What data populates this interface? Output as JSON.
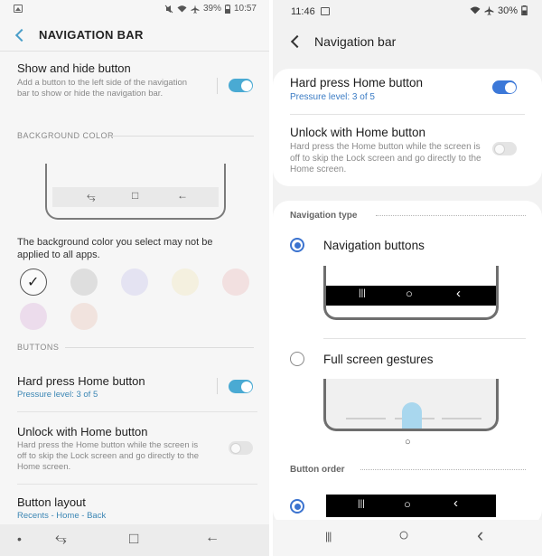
{
  "left": {
    "status": {
      "battery": "39%",
      "time": "10:57"
    },
    "header_title": "NAVIGATION BAR",
    "show_hide": {
      "title": "Show and hide button",
      "subtitle": "Add a button to the left side of the navigation bar to show or hide the navigation bar.",
      "toggle": "on"
    },
    "bg_color_head": "BACKGROUND COLOR",
    "bg_note": "The background color you select may not be applied to all apps.",
    "swatches": [
      "#fafafa",
      "#dedede",
      "#dddcf0",
      "#f3efdc",
      "#f2dede",
      "#ecdcec",
      "#f1e2dd"
    ],
    "buttons_head": "BUTTONS",
    "hard_press": {
      "title": "Hard press Home button",
      "subtitle": "Pressure level: 3 of 5",
      "toggle": "on"
    },
    "unlock": {
      "title": "Unlock with Home button",
      "subtitle": "Hard press the Home button while the screen is off to skip the Lock screen and go directly to the Home screen.",
      "toggle": "off"
    },
    "layout": {
      "title": "Button layout",
      "subtitle": "Recents - Home - Back"
    },
    "icons": {
      "back": "chevron-left-icon",
      "recents": "recents-icon",
      "home": "home-square-icon",
      "nav_back": "back-arrow-icon",
      "check": "checkmark-icon",
      "dot": "dot-icon",
      "status_left": "image-icon",
      "status_right": [
        "mute-icon",
        "wifi-icon",
        "airplane-icon"
      ]
    },
    "glyphs": {
      "recents": "⥃",
      "home": "□",
      "back": "←",
      "dot": "•",
      "check": "✓"
    }
  },
  "right": {
    "status": {
      "time": "11:46",
      "battery": "30%"
    },
    "header_title": "Navigation bar",
    "hard_press": {
      "title": "Hard press Home button",
      "subtitle": "Pressure level: 3 of 5",
      "toggle": "on"
    },
    "unlock": {
      "title": "Unlock with Home button",
      "subtitle": "Hard press the Home button while the screen is off to skip the Lock screen and go directly to the Home screen.",
      "toggle": "off"
    },
    "nav_type_head": "Navigation type",
    "nav_buttons_label": "Navigation buttons",
    "nav_buttons_selected": true,
    "gestures_label": "Full screen gestures",
    "gestures_selected": false,
    "button_order_head": "Button order",
    "icons": {
      "back": "back-arrow-icon",
      "recents": "recents-icon",
      "home": "home-circle-icon",
      "nav_back": "chevron-left-icon",
      "status_left": "image-icon",
      "status_right": [
        "wifi-icon",
        "airplane-icon"
      ]
    },
    "glyphs": {
      "recents": "|||",
      "home": "○",
      "back": "‹"
    }
  }
}
